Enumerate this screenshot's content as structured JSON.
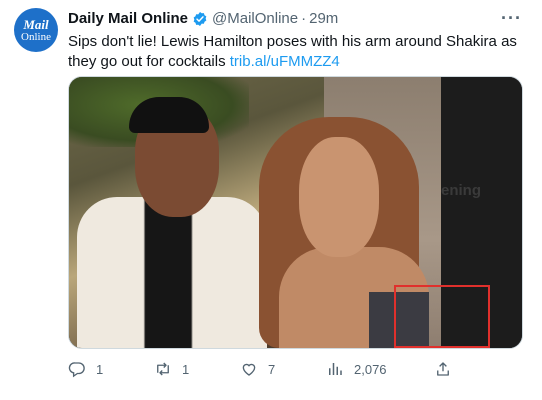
{
  "account": {
    "avatar_line1": "Mail",
    "avatar_line2": "Online",
    "name": "Daily Mail Online",
    "handle": "@MailOnline",
    "separator": "·",
    "time": "29m"
  },
  "menu": {
    "more_label": "···"
  },
  "tweet": {
    "text": "Sips don't lie! Lewis Hamilton poses with his arm around Shakira as they go out for cocktails",
    "link": "trib.al/uFMMZZ4"
  },
  "media": {
    "panel_text": "ening"
  },
  "actions": {
    "replies": "1",
    "retweets": "1",
    "likes": "7",
    "views": "2,076"
  },
  "colors": {
    "accent": "#1d9bf0",
    "verified": "#1d9bf0",
    "muted": "#536471",
    "annotation_box": "#e0302c"
  },
  "icons": [
    "verified-badge-icon",
    "more-icon",
    "reply-icon",
    "retweet-icon",
    "like-icon",
    "views-icon",
    "share-icon"
  ]
}
